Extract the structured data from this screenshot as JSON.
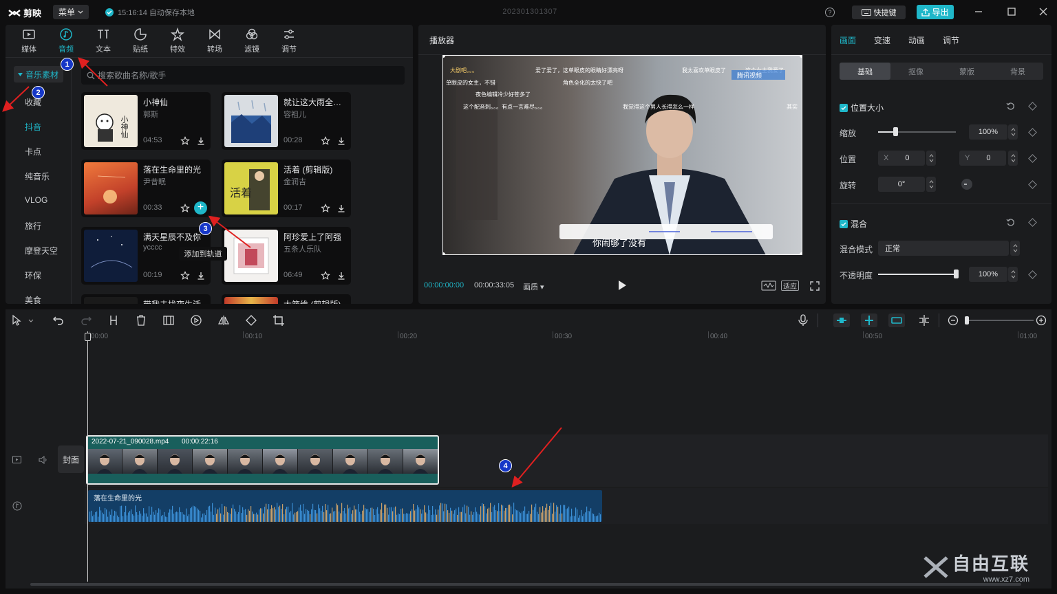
{
  "app": {
    "logo_text": "剪映",
    "menu_label": "菜单",
    "autosave_text": "15:16:14 自动保存本地",
    "project_name": "202301301307",
    "shortcut_label": "快捷键",
    "export_label": "导出",
    "help_glyph": "?"
  },
  "colors": {
    "accent": "#1fb7c9",
    "panel": "#1b1c1e",
    "video_clip": "#195f5c",
    "audio_clip": "#133e66",
    "annotation_badge": "#1637c7",
    "annotation_arrow": "#e02020"
  },
  "media_tabs": [
    {
      "label": "媒体",
      "icon": "media-icon"
    },
    {
      "label": "音频",
      "icon": "audio-icon"
    },
    {
      "label": "文本",
      "icon": "text-icon"
    },
    {
      "label": "贴纸",
      "icon": "sticker-icon"
    },
    {
      "label": "特效",
      "icon": "effects-icon"
    },
    {
      "label": "转场",
      "icon": "transition-icon"
    },
    {
      "label": "滤镜",
      "icon": "filter-icon"
    },
    {
      "label": "调节",
      "icon": "adjust-icon"
    }
  ],
  "sidebar": {
    "active_group": "音乐素材",
    "items": [
      "收藏",
      "抖音",
      "卡点",
      "纯音乐",
      "VLOG",
      "旅行",
      "摩登天空",
      "环保",
      "美食"
    ]
  },
  "search": {
    "placeholder": "搜索歌曲名称/歌手"
  },
  "songs": [
    {
      "title": "小神仙",
      "artist": "郭斯",
      "duration": "04:53"
    },
    {
      "title": "就让这大雨全都落下",
      "artist": "容祖儿",
      "duration": "00:28"
    },
    {
      "title": "落在生命里的光",
      "artist": "尹昔眠",
      "duration": "00:33"
    },
    {
      "title": "活着 (剪辑版)",
      "artist": "金润吉",
      "duration": "00:17"
    },
    {
      "title": "满天星辰不及你",
      "artist": "ycccc",
      "duration": "00:19"
    },
    {
      "title": "阿珍爱上了阿强",
      "artist": "五条人乐队",
      "duration": "06:49"
    },
    {
      "title": "带我去找夜生活",
      "artist": "",
      "duration": ""
    },
    {
      "title": "大箱维 (剪辑版)",
      "artist": "",
      "duration": ""
    }
  ],
  "add_tooltip": "添加到轨道",
  "thumb_texts": {
    "song1": "小神仙",
    "song4": "活着"
  },
  "player": {
    "title": "播放器",
    "current_time": "00:00:00:00",
    "total_time": "00:00:33:05",
    "quality_label": "画质",
    "fit_label": "适应",
    "subtitle": "你闹够了没有",
    "danmaku": [
      "大剧吧。。。",
      "爱了爱了，这单眼皮的眼睛好漂亮呀",
      "我太喜欢单眼皮了",
      "这个女主我爱了",
      "单眼皮的女主，不错",
      "角色全化的太快了吧",
      "腾讯视频",
      "夜色编辑冷少好苍多了",
      "这个配音刺。。。有点一言难尽。。。",
      "我觉得这个男人长得怎么一样",
      "其实"
    ]
  },
  "inspector": {
    "tabs": [
      "画面",
      "变速",
      "动画",
      "调节"
    ],
    "subtabs": [
      "基础",
      "抠像",
      "蒙版",
      "背景"
    ],
    "position_section": "位置大小",
    "scale_label": "缩放",
    "scale_value": "100%",
    "scale_level": 0.22,
    "position_label": "位置",
    "x_label": "X",
    "x_value": "0",
    "y_label": "Y",
    "y_value": "0",
    "rotate_label": "旋转",
    "rotate_value": "0°",
    "blend_section": "混合",
    "blend_mode_label": "混合模式",
    "blend_mode_value": "正常",
    "opacity_label": "不透明度",
    "opacity_value": "100%",
    "opacity_level": 1.0
  },
  "timeline": {
    "ruler": [
      "00:00",
      "00:10",
      "00:20",
      "00:30",
      "00:40",
      "00:50",
      "01:00"
    ],
    "cover_label": "封面",
    "video_clip_name": "2022-07-21_090028.mp4",
    "video_clip_duration": "00:00:22:16",
    "audio_clip_name": "落在生命里的光"
  },
  "annotations": [
    "1",
    "2",
    "3",
    "4"
  ],
  "watermark": {
    "brand": "自由互联",
    "url": "www.xz7.com"
  }
}
